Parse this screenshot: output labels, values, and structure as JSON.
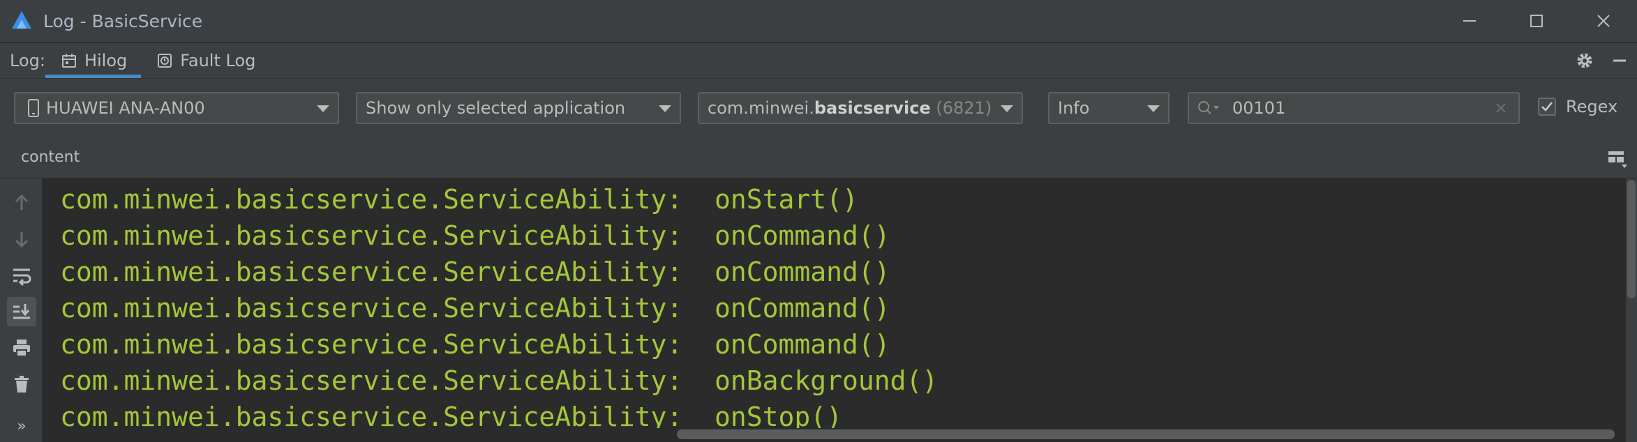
{
  "window": {
    "title": "Log - BasicService",
    "controls": [
      "minimize",
      "maximize",
      "close"
    ]
  },
  "tabbar": {
    "prefix": "Log:",
    "tabs": [
      {
        "label": "Hilog",
        "icon": "calendar-log-icon",
        "active": true
      },
      {
        "label": "Fault Log",
        "icon": "fault-log-icon",
        "active": false
      }
    ]
  },
  "filters": {
    "device": "HUAWEI ANA-AN00",
    "app_filter": "Show only selected application",
    "process": {
      "prefix": "com.minwei.",
      "name": "basicservice",
      "pid": "(6821)"
    },
    "level": "Info",
    "search": {
      "value": "00101"
    },
    "regex": {
      "label": "Regex",
      "checked": true
    }
  },
  "content": {
    "header": "content",
    "lines": [
      {
        "source": "com.minwei.basicservice.ServiceAbility:",
        "message": "onStart()"
      },
      {
        "source": "com.minwei.basicservice.ServiceAbility:",
        "message": "onCommand()"
      },
      {
        "source": "com.minwei.basicservice.ServiceAbility:",
        "message": "onCommand()"
      },
      {
        "source": "com.minwei.basicservice.ServiceAbility:",
        "message": "onCommand()"
      },
      {
        "source": "com.minwei.basicservice.ServiceAbility:",
        "message": "onCommand()"
      },
      {
        "source": "com.minwei.basicservice.ServiceAbility:",
        "message": "onBackground()"
      },
      {
        "source": "com.minwei.basicservice.ServiceAbility:",
        "message": "onStop()"
      }
    ]
  },
  "gutter": {
    "buttons": [
      "up-arrow-icon",
      "down-arrow-icon",
      "soft-wrap-icon",
      "scroll-to-end-icon",
      "print-icon",
      "trash-icon",
      "more-icon"
    ],
    "more_label": "»"
  },
  "colors": {
    "log_text": "#a4c639",
    "background": "#2b2b2b",
    "accent": "#4a88c7"
  }
}
